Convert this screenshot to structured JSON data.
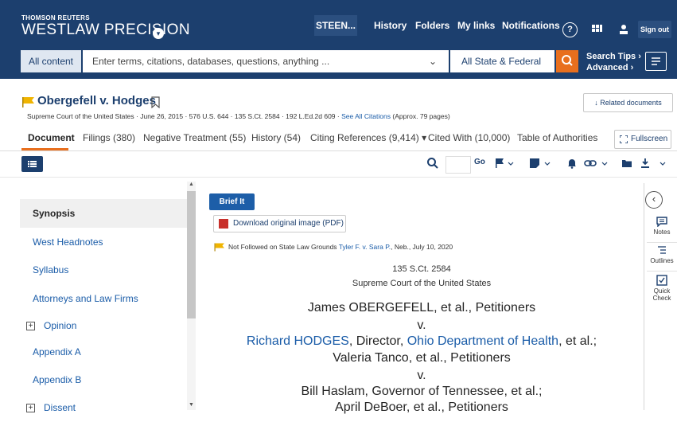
{
  "brand": {
    "company": "THOMSON REUTERS",
    "product": "WESTLAW PRECISION"
  },
  "nav": {
    "user": "STEEN...",
    "links": [
      "History",
      "Folders",
      "My links",
      "Notifications"
    ],
    "help": "?",
    "signout": "Sign out"
  },
  "search": {
    "scope": "All content",
    "placeholder": "Enter terms, citations, databases, questions, anything ...",
    "jurisdiction": "All State & Federal",
    "tips": "Search Tips",
    "advanced": "Advanced"
  },
  "document": {
    "title": "Obergefell v. Hodges",
    "court": "Supreme Court of the United States",
    "date": "June 26, 2015",
    "cite1": "576 U.S. 644",
    "cite2": "135 S.Ct. 2584",
    "cite3": "192 L.Ed.2d 609",
    "see_all": "See All Citations",
    "pages": "(Approx. 79 pages)",
    "related": "Related documents"
  },
  "tabs": [
    "Document",
    "Filings (380)",
    "Negative Treatment (55)",
    "History (54)",
    "Citing References (9,414)",
    "Cited With (10,000)",
    "Table of Authorities"
  ],
  "fullscreen": "Fullscreen",
  "toolbar": {
    "go": "Go"
  },
  "toc": {
    "items": [
      "Synopsis",
      "West Headnotes",
      "Syllabus",
      "Attorneys and Law Firms",
      "Opinion",
      "Appendix A",
      "Appendix B",
      "Dissent"
    ]
  },
  "content": {
    "brief_it": "Brief It",
    "download_pdf": "Download original image (PDF)",
    "kc_flag_text": "Not Followed on State Law Grounds",
    "kc_case": "Tyler F. v. Sara P.",
    "kc_rest": ", Neb., July 10, 2020",
    "reporter": "135 S.Ct. 2584",
    "court_line": "Supreme Court of the United States",
    "party1": "James OBERGEFELL, et al., Petitioners",
    "v1": "v.",
    "party2_name": "Richard HODGES",
    "party2_mid": ", Director, ",
    "party2_agency": "Ohio Department of Health",
    "party2_end": ", et al.;",
    "party3": "Valeria Tanco, et al., Petitioners",
    "v2": "v.",
    "party4": "Bill Haslam, Governor of Tennessee, et al.;",
    "party5": "April DeBoer, et al., Petitioners"
  },
  "side_panel": {
    "notes": "Notes",
    "outlines": "Outlines",
    "quick_check": "Quick Check"
  },
  "colors": {
    "nav_bg": "#1c3f6e",
    "accent": "#e86f1e",
    "link": "#1a5ca8",
    "flag": "#f0b400",
    "brief_it_bg": "#1d5ea8"
  }
}
